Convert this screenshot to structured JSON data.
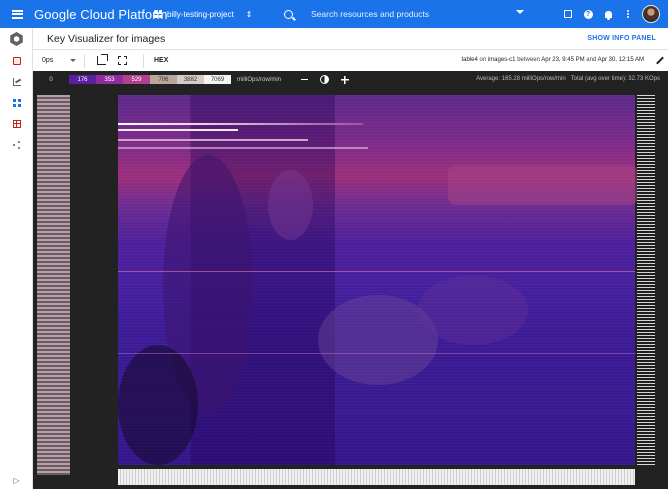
{
  "topbar": {
    "brand": "Google Cloud Platform",
    "project": "billy-testing-project",
    "search_placeholder": "Search resources and products"
  },
  "page": {
    "title": "Key Visualizer for images",
    "show_info_panel": "SHOW INFO PANEL"
  },
  "toolbar": {
    "metric": "0ps",
    "hex_label": "HEX",
    "table": "table4",
    "on_label": "on",
    "instance": "images-c1",
    "between_label": "between",
    "start": "Apr 23, 9:45 PM",
    "and_label": "and",
    "end": "Apr 30, 12:15 AM"
  },
  "legend": {
    "zero": "0",
    "segments": [
      {
        "label": "176",
        "color": "#5b1fa0"
      },
      {
        "label": "353",
        "color": "#8e2ca0"
      },
      {
        "label": "529",
        "color": "#b04090"
      },
      {
        "label": "706",
        "color": "#b8a79a"
      },
      {
        "label": "3882",
        "color": "#d5ccc5"
      },
      {
        "label": "7069",
        "color": "#f4f4f4"
      }
    ],
    "unit": "milliOps/row/min",
    "average": "Average: 165.28 milliOps/row/min",
    "total": "Total (avg over time): 32.73 KOps"
  },
  "colors": {
    "brand_blue": "#1a73e8",
    "heatmap_base": "#3a1a92",
    "heatmap_hot": "#9b2f7c"
  }
}
